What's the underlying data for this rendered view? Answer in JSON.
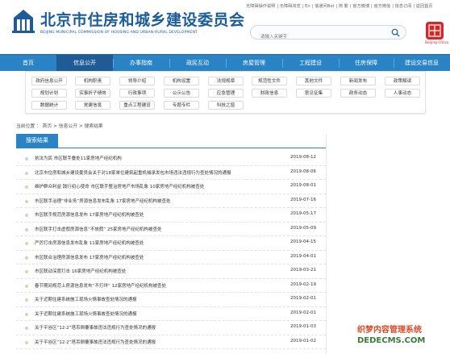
{
  "header": {
    "title": "北京市住房和城乡建设委员会",
    "subtitle": "BEIJING MUNICIPAL COMMISSION OF HOUSING AND URBAN-RURAL DEVELOPMENT",
    "top_links": [
      "无障碍操作说明",
      "无障碍浏览",
      "En",
      "信通问Bot",
      "简 繁",
      "官方微博",
      "官方微信",
      "信息订阅",
      "返回首页"
    ],
    "search_placeholder": "请输入关键字",
    "seal_text": "Beijing·China"
  },
  "nav": {
    "items": [
      "首页",
      "信息公开",
      "办事指南",
      "政民互动",
      "房屋管理",
      "工程建设",
      "住房保障",
      "建设交易信息"
    ],
    "active_index": 1
  },
  "subnav": {
    "row1": [
      "政府信息公开",
      "机构职责",
      "领导介绍",
      "机构设置",
      "法规规章",
      "规范性文件",
      "其他文件",
      "新闻发布",
      "政策解读"
    ],
    "row2": [
      "规划计划",
      "实事折子绩效",
      "行政事项",
      "公示公告",
      "应急管理",
      "财政信息",
      "意见征集",
      "政务动态",
      "人事动态"
    ],
    "row3": [
      "数据统计",
      "党建信息",
      "重点工程建设",
      "专题专栏",
      "科技之窗"
    ]
  },
  "breadcrumb": "当前位置 ： 首页 > 信息公开 > 搜索结果",
  "results": {
    "tab_label": "搜索结果",
    "items": [
      {
        "title": "执法为民 市区联手叠处11家房地产经纪机构",
        "date": "2019-08-12"
      },
      {
        "title": "北京市住房和城乡建设委员会关于对18家单位建筑起重机械承发包市场违法违规行为查处情况的通报",
        "date": "2019-08-06"
      },
      {
        "title": "维护群众利益 践行初心使命 市区联手整治房地产市场乱象 10家房地产经纪机构被查处",
        "date": "2019-08-01"
      },
      {
        "title": "市区联手治理“非业务”房源信息发布乱象 17家房地产经纪机构被查处",
        "date": "2019-07-16"
      },
      {
        "title": "市区联手规范房源信息发布 17家房地产经纪机构被查处",
        "date": "2019-05-17"
      },
      {
        "title": "市区联手打击虚假房源信息“不放假” 25家房地产经纪机构被查处",
        "date": "2019-05-09"
      },
      {
        "title": "严厉打击房源信息发布乱象 11家房地产经纪机构被查处",
        "date": "2019-04-15"
      },
      {
        "title": "市区联合治理房源信息发布 17家房地产经纪机构被查处",
        "date": "2019-04-01"
      },
      {
        "title": "市区联动深度打击 16家房地产经纪机构被查处",
        "date": "2019-03-21"
      },
      {
        "title": "春节期间规范上房源信息发布“不打烊” 12家房地产经纪机构被查处",
        "date": "2019-02-19"
      },
      {
        "title": "关于近期住建系统施工现场火情事故查处情况的通报",
        "date": "2019-02-01"
      },
      {
        "title": "关于近期住建系统施工现场火情事故查处情况的通报",
        "date": "2019-02-01"
      },
      {
        "title": "关于平谷区“12·2”塔吊倒覆事故违法违规行为查处情况的通报",
        "date": "2019-01-03"
      },
      {
        "title": "关于平谷区“12·2”塔吊倒覆事故违法违规行为查处情况的通报",
        "date": "2019-01-02"
      }
    ]
  },
  "watermark": {
    "line1": "织梦内容管理系统",
    "line2": "DEDECMS.COM"
  },
  "colors": {
    "brand_blue": "#2a83c4",
    "title_blue": "#1b5c9a",
    "seal_red": "#cf2a2a"
  }
}
